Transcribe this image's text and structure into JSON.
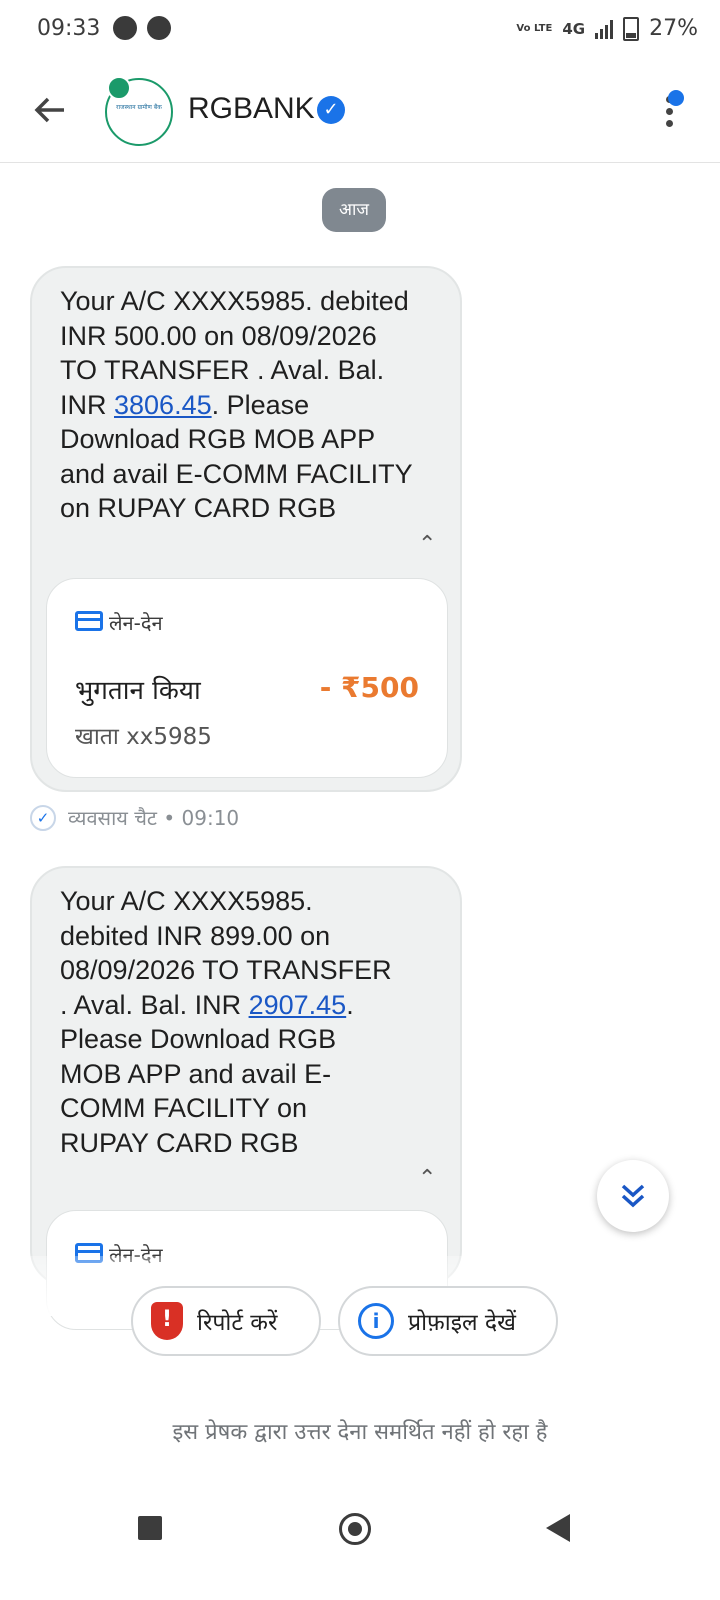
{
  "status_bar": {
    "time": "09:33",
    "volte": "Vo LTE",
    "network": "4G",
    "battery": "27%"
  },
  "header": {
    "title": "RGBANK",
    "logo_text": "राजस्थान ग्रामीण बैंक",
    "icons": [
      "back-arrow-icon",
      "verified-badge-icon",
      "more-vert-icon"
    ]
  },
  "conversation": {
    "date_chip": "आज",
    "messages": [
      {
        "text_before": "Your A/C XXXX5985. debited INR 500.00 on 08/09/2026 TO TRANSFER . Aval. Bal. INR ",
        "link": "3806.45",
        "text_after": ". Please Download RGB MOB APP and avail E-COMM FACILITY on RUPAY CARD RGB",
        "card": {
          "tag": "लेन-देन",
          "label": "भुगतान किया",
          "amount": "- ₹500",
          "account": "खाता xx5985"
        },
        "meta": "व्यवसाय चैट • 09:10"
      },
      {
        "text_before": "Your A/C XXXX5985. debited INR 899.00 on 08/09/2026 TO TRANSFER . Aval. Bal. INR ",
        "link": "2907.45",
        "text_after": ". Please Download RGB MOB APP and avail E-COMM FACILITY on RUPAY CARD RGB",
        "card": {
          "tag": "लेन-देन"
        }
      }
    ]
  },
  "actions": {
    "report": "रिपोर्ट करें",
    "profile": "प्रोफ़ाइल देखें"
  },
  "footer": {
    "no_reply": "इस प्रेषक द्वारा उत्तर देना समर्थित नहीं हो रहा है"
  },
  "colors": {
    "accent": "#1a73e8",
    "amount": "#ea7a30",
    "report": "#d93025"
  }
}
